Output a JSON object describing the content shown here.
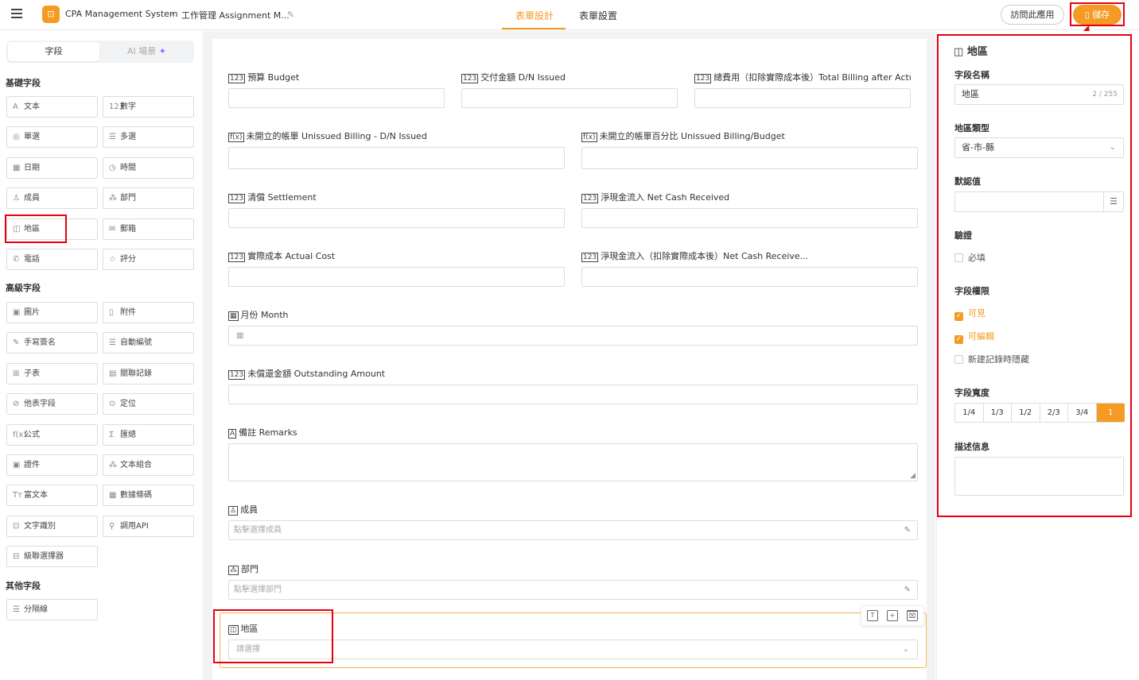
{
  "header": {
    "app_logo": "⊡",
    "app_name": "CPA Management System",
    "form_name": "工作管理 Assignment M...",
    "tabs": [
      "表單設計",
      "表單設置"
    ],
    "visit_label": "訪問此應用",
    "save_label": "儲存"
  },
  "left_panel": {
    "segments": [
      "字段",
      "AI 場景"
    ],
    "groups": [
      {
        "title": "基礎字段",
        "items": [
          {
            "icon": "A",
            "label": "文本"
          },
          {
            "icon": "123",
            "label": "數字"
          },
          {
            "icon": "◎",
            "label": "單選"
          },
          {
            "icon": "☰",
            "label": "多選"
          },
          {
            "icon": "▦",
            "label": "日期"
          },
          {
            "icon": "◷",
            "label": "時間"
          },
          {
            "icon": "♙",
            "label": "成員"
          },
          {
            "icon": "⁂",
            "label": "部門"
          },
          {
            "icon": "◫",
            "label": "地區"
          },
          {
            "icon": "✉",
            "label": "郵箱"
          },
          {
            "icon": "✆",
            "label": "電話"
          },
          {
            "icon": "☆",
            "label": "評分"
          }
        ]
      },
      {
        "title": "高級字段",
        "items": [
          {
            "icon": "▣",
            "label": "圖片"
          },
          {
            "icon": "▯",
            "label": "附件"
          },
          {
            "icon": "✎",
            "label": "手寫簽名"
          },
          {
            "icon": "☰",
            "label": "自動編號"
          },
          {
            "icon": "⊞",
            "label": "子表"
          },
          {
            "icon": "▤",
            "label": "關聯記錄"
          },
          {
            "icon": "⊘",
            "label": "他表字段"
          },
          {
            "icon": "⊙",
            "label": "定位"
          },
          {
            "icon": "f(x)",
            "label": "公式"
          },
          {
            "icon": "Σ",
            "label": "匯總"
          },
          {
            "icon": "▣",
            "label": "證件"
          },
          {
            "icon": "⁂",
            "label": "文本組合"
          },
          {
            "icon": "Tт",
            "label": "富文本"
          },
          {
            "icon": "▦",
            "label": "數據條碼"
          },
          {
            "icon": "⊡",
            "label": "文字識別"
          },
          {
            "icon": "⚲",
            "label": "調用API"
          },
          {
            "icon": "⊟",
            "label": "級聯選擇器"
          }
        ]
      },
      {
        "title": "其他字段",
        "items": [
          {
            "icon": "☰",
            "label": "分隔線"
          }
        ]
      }
    ]
  },
  "canvas": {
    "fields": [
      {
        "icon": "123",
        "label": "預算 Budget"
      },
      {
        "icon": "123",
        "label": "交付金額 D/N Issued"
      },
      {
        "icon": "123",
        "label": "總費用（扣除實際成本後）Total Billing after Actu..."
      },
      {
        "icon": "f(x)",
        "label": "未開立的帳單 Unissued Billing - D/N Issued"
      },
      {
        "icon": "f(x)",
        "label": "未開立的帳單百分比 Unissued Billing/Budget"
      },
      {
        "icon": "123",
        "label": "清償 Settlement"
      },
      {
        "icon": "123",
        "label": "淨現金流入 Net Cash Received"
      },
      {
        "icon": "123",
        "label": "實際成本 Actual Cost"
      },
      {
        "icon": "123",
        "label": "淨現金流入（扣除實際成本後）Net Cash Receive..."
      },
      {
        "icon": "▦",
        "label": "月份 Month"
      },
      {
        "icon": "123",
        "label": "未償還金額 Outstanding Amount"
      },
      {
        "icon": "A",
        "label": "備註 Remarks"
      },
      {
        "icon": "♙",
        "label": "成員",
        "placeholder": "點擊選擇成員"
      },
      {
        "icon": "⁂",
        "label": "部門",
        "placeholder": "點擊選擇部門"
      },
      {
        "icon": "◫",
        "label": "地區",
        "placeholder": "請選擇"
      }
    ]
  },
  "right_panel": {
    "title_icon": "◫",
    "title": "地區",
    "name_label": "字段名稱",
    "name_value": "地區",
    "name_counter": "2 / 255",
    "type_label": "地區類型",
    "type_value": "省-市-縣",
    "default_label": "默認值",
    "validate_label": "驗證",
    "required_label": "必填",
    "perm_label": "字段權限",
    "perm_visible": "可見",
    "perm_editable": "可編輯",
    "perm_hide_new": "新建記錄時隱藏",
    "width_label": "字段寬度",
    "width_options": [
      "1/4",
      "1/3",
      "1/2",
      "2/3",
      "3/4",
      "1"
    ],
    "width_selected": "1",
    "desc_label": "描述信息"
  },
  "colors": {
    "accent": "#f59a23",
    "annotation_red": "#e60012"
  }
}
